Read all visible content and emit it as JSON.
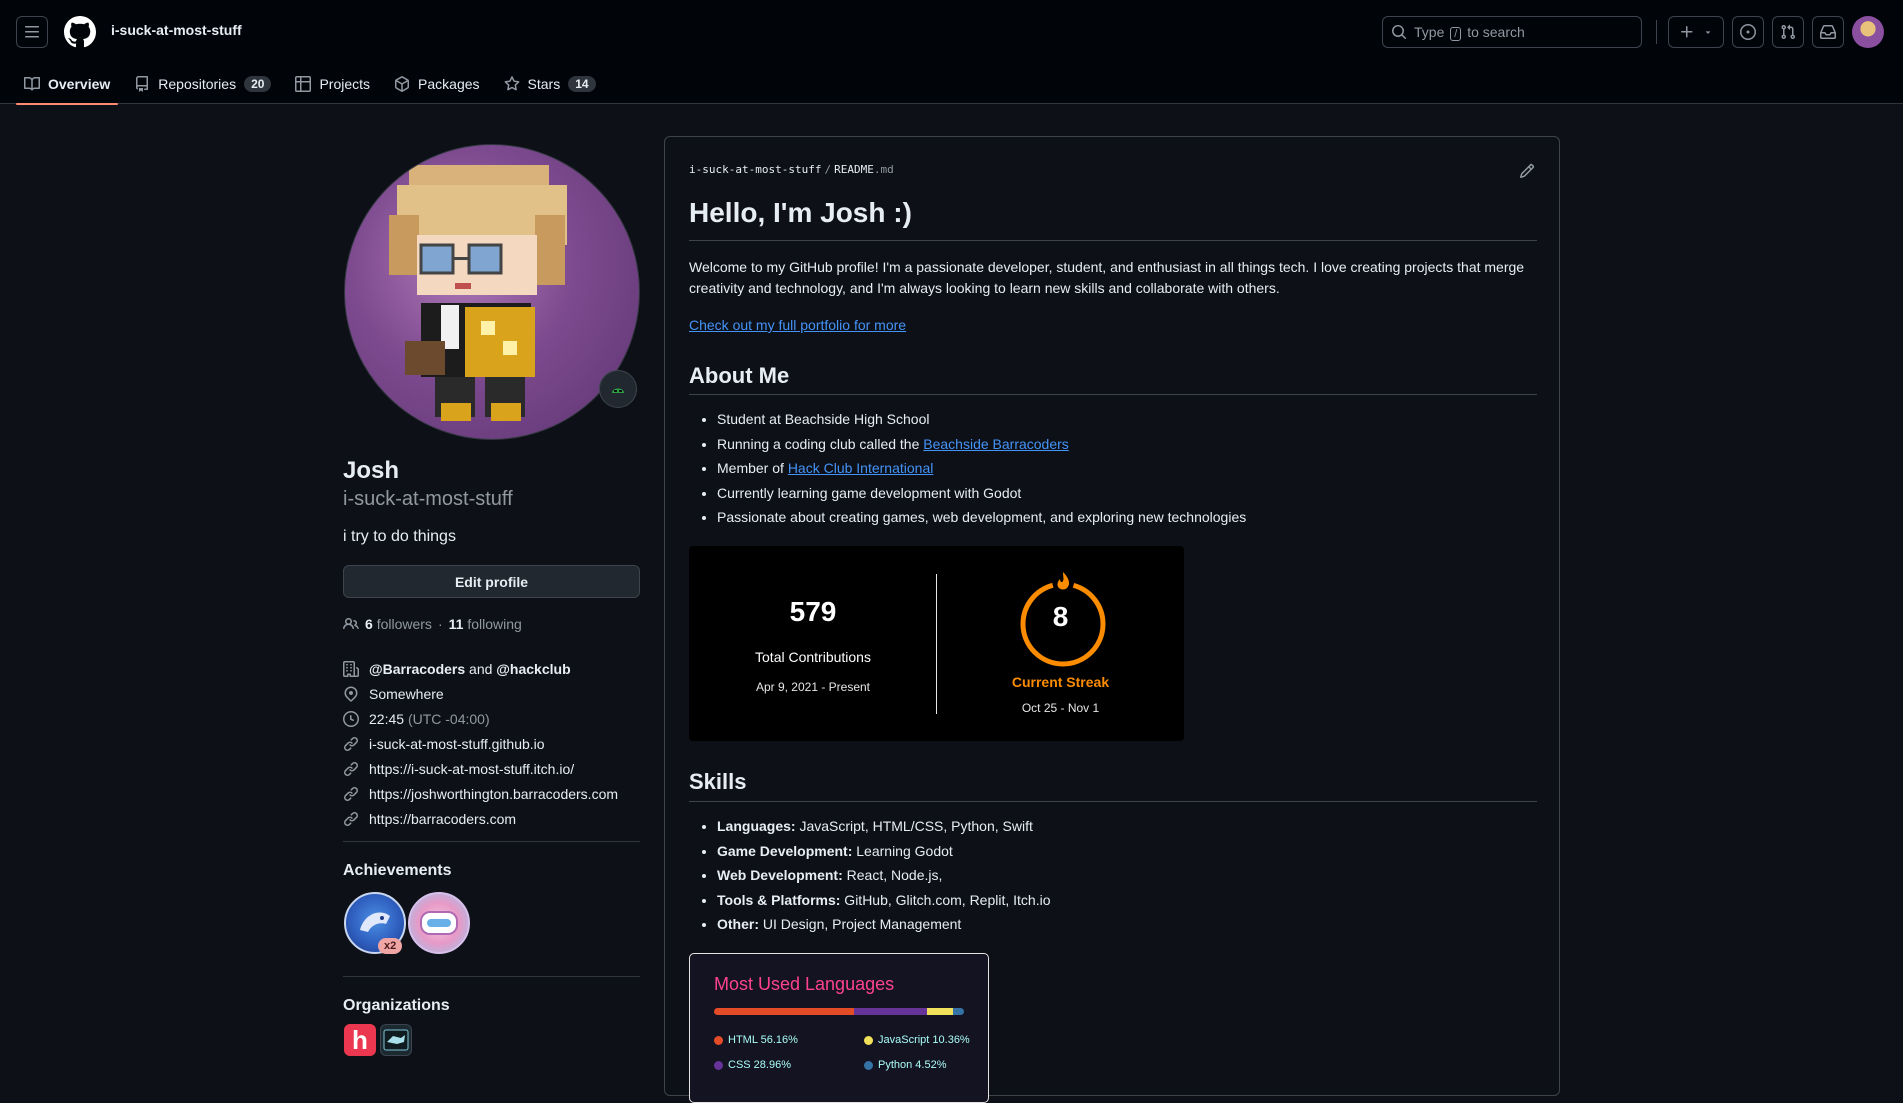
{
  "header": {
    "username": "i-suck-at-most-stuff",
    "search_prefix": "Type",
    "search_key": "/",
    "search_suffix": "to search"
  },
  "tabs": [
    {
      "label": "Overview",
      "icon": "book-icon",
      "active": true
    },
    {
      "label": "Repositories",
      "icon": "repo-icon",
      "count": "20"
    },
    {
      "label": "Projects",
      "icon": "table-icon"
    },
    {
      "label": "Packages",
      "icon": "package-icon"
    },
    {
      "label": "Stars",
      "icon": "star-icon",
      "count": "14"
    }
  ],
  "profile": {
    "name": "Josh",
    "login": "i-suck-at-most-stuff",
    "bio": "i try to do things",
    "edit_label": "Edit profile",
    "followers": "6",
    "followers_label": "followers",
    "following": "11",
    "following_label": "following",
    "dot": "·",
    "org1": "@Barracoders",
    "and": "and",
    "org2": "@hackclub",
    "location": "Somewhere",
    "time": "22:45",
    "tz": "(UTC -04:00)",
    "links": [
      "i-suck-at-most-stuff.github.io",
      "https://i-suck-at-most-stuff.itch.io/",
      "https://joshworthington.barracoders.com",
      "https://barracoders.com"
    ],
    "achievements_title": "Achievements",
    "achievement_multiplier": "x2",
    "organizations_title": "Organizations",
    "org_hackclub_letter": "h"
  },
  "readme": {
    "path_owner": "i-suck-at-most-stuff",
    "path_sep": "/",
    "path_file": "README",
    "path_ext": ".md",
    "title": "Hello, I'm Josh :)",
    "intro": "Welcome to my GitHub profile! I'm a passionate developer, student, and enthusiast in all things tech. I love creating projects that merge creativity and technology, and I'm always looking to learn new skills and collaborate with others.",
    "portfolio_link": "Check out my full portfolio for more",
    "about_title": "About Me",
    "about": {
      "item1": "Student at Beachside High School",
      "item2_pre": "Running a coding club called the ",
      "item2_link": "Beachside Barracoders",
      "item3_pre": "Member of ",
      "item3_link": "Hack Club International",
      "item4": "Currently learning game development with Godot",
      "item5": "Passionate about creating games, web development, and exploring new technologies"
    },
    "skills_title": "Skills",
    "skills": [
      {
        "label": "Languages:",
        "value": " JavaScript, HTML/CSS, Python, Swift"
      },
      {
        "label": "Game Development:",
        "value": " Learning Godot"
      },
      {
        "label": "Web Development:",
        "value": " React, Node.js,"
      },
      {
        "label": "Tools & Platforms:",
        "value": " GitHub, Glitch.com, Replit, Itch.io"
      },
      {
        "label": "Other:",
        "value": " UI Design, Project Management"
      }
    ]
  },
  "streak_card": {
    "total": "579",
    "total_label": "Total Contributions",
    "total_range": "Apr 9, 2021 - Present",
    "streak": "8",
    "streak_label": "Current Streak",
    "streak_range": "Oct 25 - Nov 1",
    "ring_color": "#fb8c00"
  },
  "languages_card": {
    "title": "Most Used Languages",
    "languages": [
      {
        "name": "HTML",
        "percent": 56.16,
        "label": "HTML 56.16%",
        "color": "#e34c26"
      },
      {
        "name": "CSS",
        "percent": 28.96,
        "label": "CSS 28.96%",
        "color": "#663399"
      },
      {
        "name": "JavaScript",
        "percent": 10.36,
        "label": "JavaScript 10.36%",
        "color": "#f1e05a"
      },
      {
        "name": "Python",
        "percent": 4.52,
        "label": "Python 4.52%",
        "color": "#3572A5"
      }
    ]
  },
  "colors": {
    "accent_tab": "#fd8c73",
    "link": "#4493f8",
    "bg": "#0d1117",
    "header_bg": "#010409"
  }
}
